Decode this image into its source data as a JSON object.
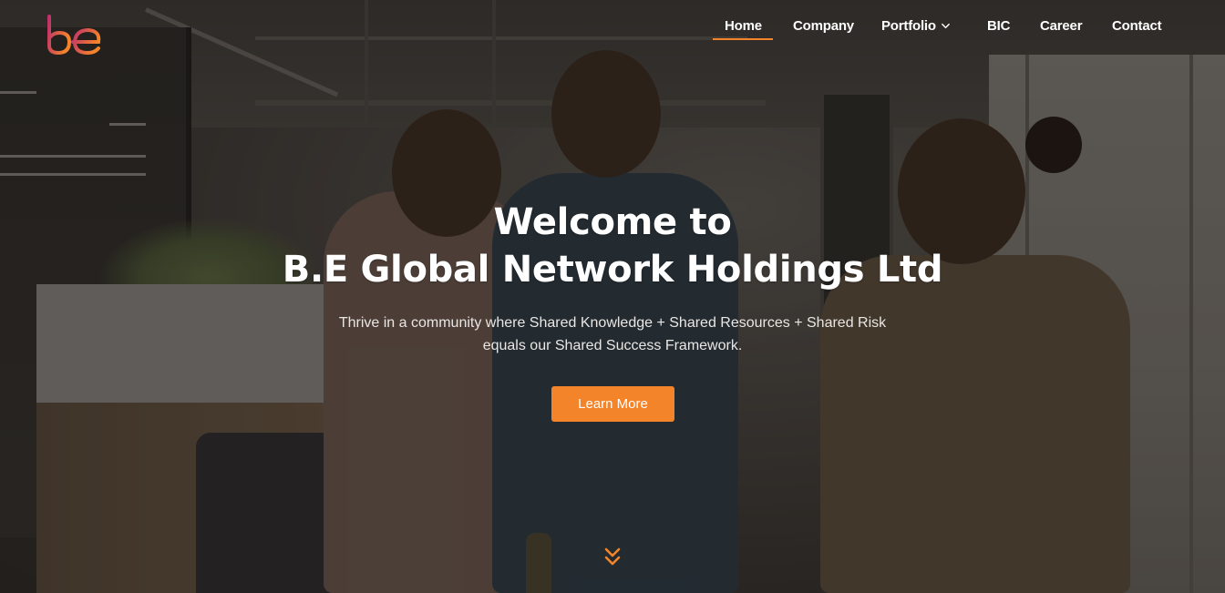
{
  "brand": {
    "logo_text": "be",
    "accent_color": "#f4842a",
    "logo_gradient": [
      "#c0306a",
      "#f4842a"
    ]
  },
  "nav": {
    "items": [
      {
        "label": "Home",
        "active": true
      },
      {
        "label": "Company",
        "active": false
      },
      {
        "label": "Portfolio",
        "active": false,
        "has_dropdown": true,
        "icon": "chevron-down-icon"
      },
      {
        "label": "BIC",
        "active": false
      },
      {
        "label": "Career",
        "active": false
      },
      {
        "label": "Contact",
        "active": false
      }
    ]
  },
  "hero": {
    "title_line1": "Welcome to",
    "title_line2": "B.E Global Network Holdings Ltd",
    "subtitle_line1": "Thrive in a community where Shared Knowledge + Shared Resources + Shared Risk",
    "subtitle_line2": "equals our Shared Success Framework.",
    "cta_label": "Learn More",
    "scroll_icon": "double-chevron-down-icon"
  }
}
